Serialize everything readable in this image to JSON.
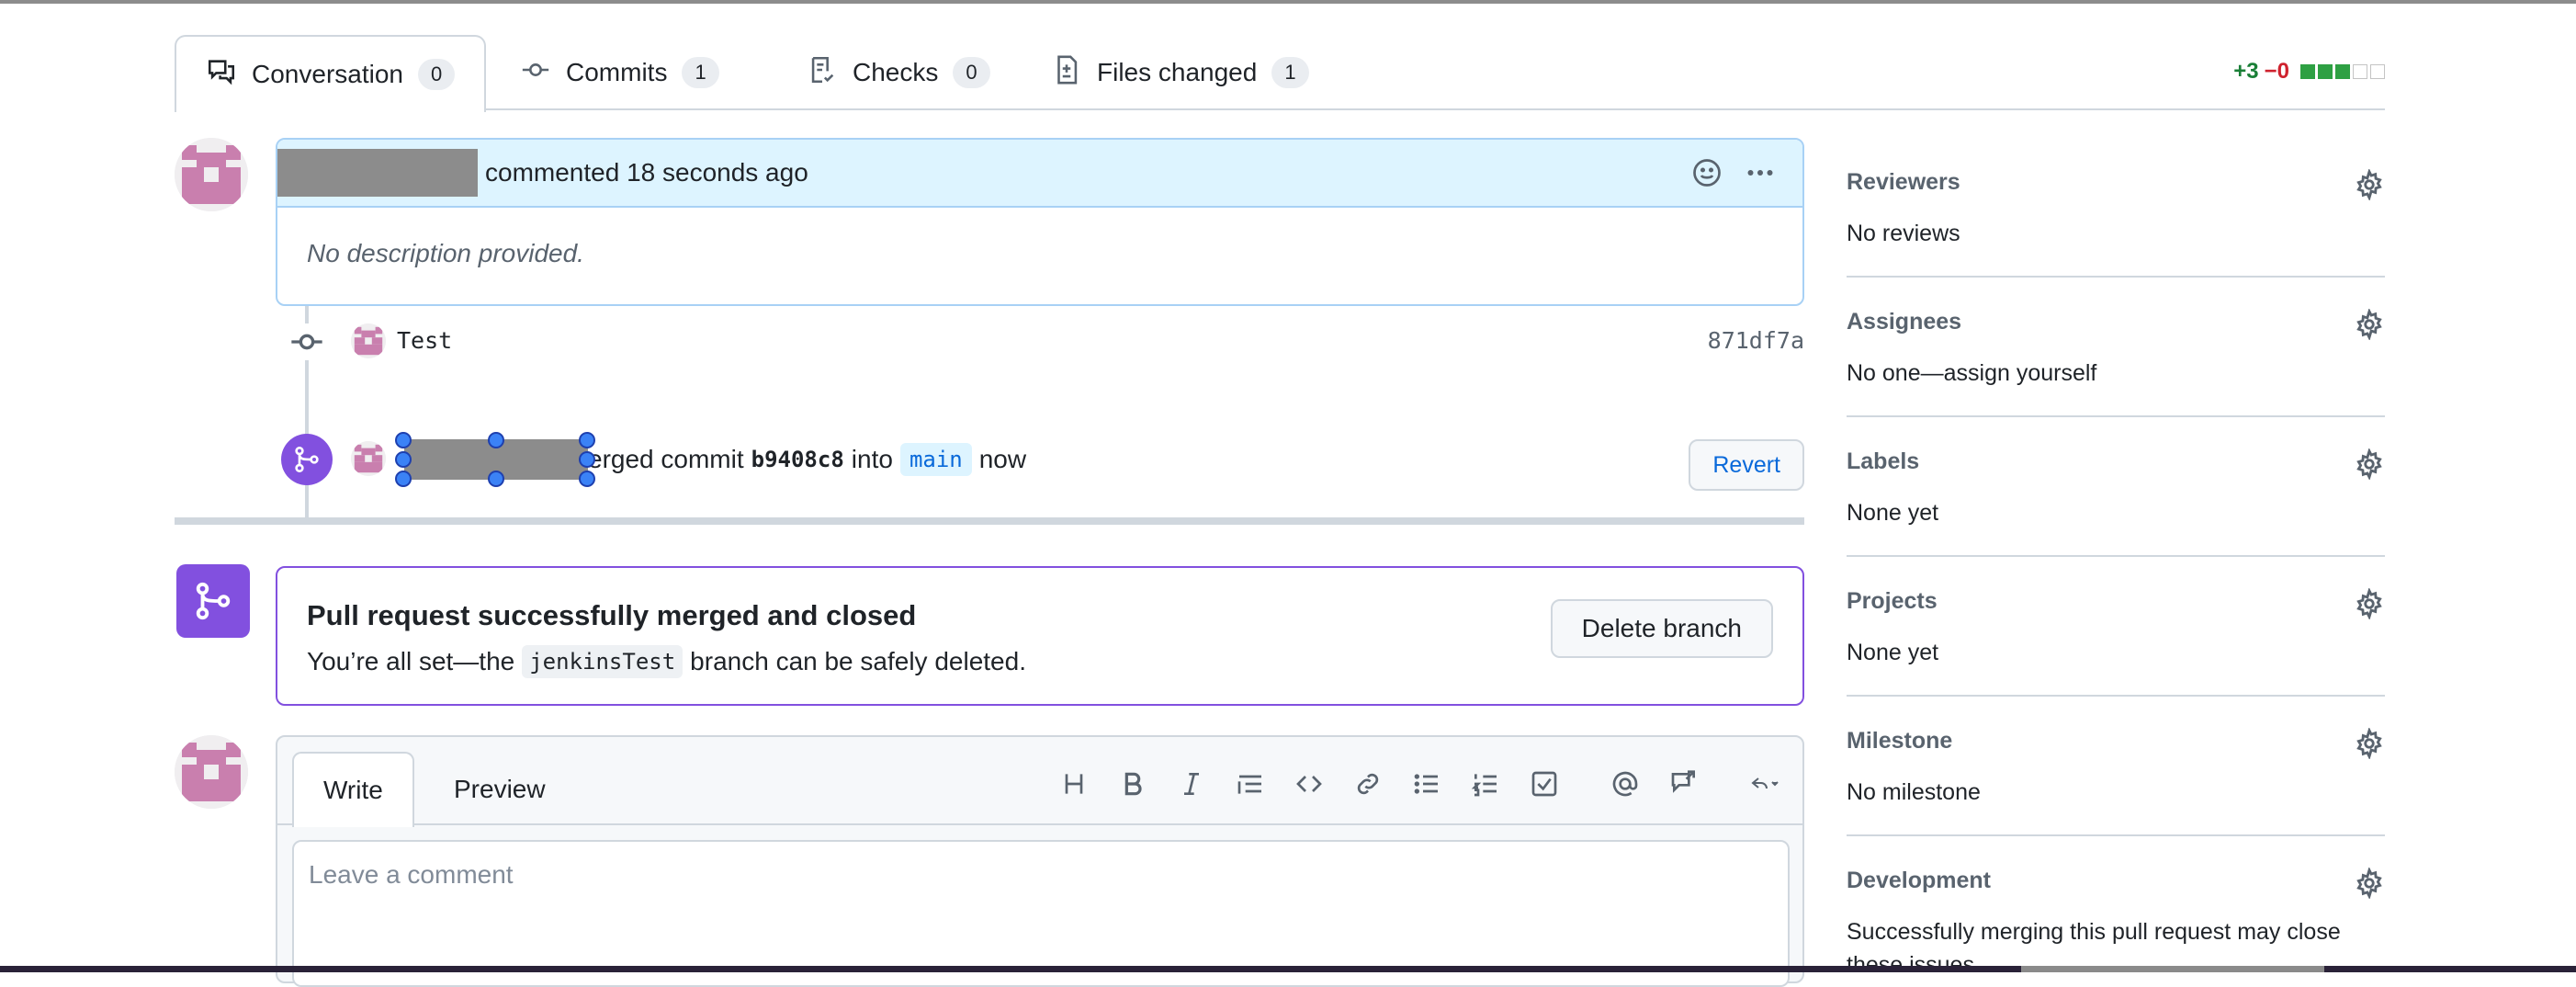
{
  "tabs": [
    {
      "label": "Conversation",
      "count": "0"
    },
    {
      "label": "Commits",
      "count": "1"
    },
    {
      "label": "Checks",
      "count": "0"
    },
    {
      "label": "Files changed",
      "count": "1"
    }
  ],
  "diffstat": {
    "additions": "+3",
    "deletions": "−0"
  },
  "comment": {
    "header_text": "commented 18 seconds ago",
    "body": "No description provided."
  },
  "commit": {
    "message": "Test",
    "sha": "871df7a"
  },
  "merge_event": {
    "prefix": "erged commit",
    "sha": "b9408c8",
    "into": "into",
    "branch": "main",
    "time": "now",
    "revert_label": "Revert"
  },
  "merged_box": {
    "title": "Pull request successfully merged and closed",
    "sub_before": "You’re all set—the",
    "branch": "jenkinsTest",
    "sub_after": "branch can be safely deleted.",
    "delete_label": "Delete branch"
  },
  "editor": {
    "write_tab": "Write",
    "preview_tab": "Preview",
    "placeholder": "Leave a comment"
  },
  "sidebar": [
    {
      "title": "Reviewers",
      "value": "No reviews"
    },
    {
      "title": "Assignees",
      "value": "No one—assign yourself"
    },
    {
      "title": "Labels",
      "value": "None yet"
    },
    {
      "title": "Projects",
      "value": "None yet"
    },
    {
      "title": "Milestone",
      "value": "No milestone"
    },
    {
      "title": "Development",
      "value": "Successfully merging this pull request may close these issues."
    }
  ],
  "colors": {
    "accent_blue": "#0969da",
    "merged_purple": "#8250df",
    "add_green": "#1a7f37",
    "del_red": "#cf222e"
  }
}
